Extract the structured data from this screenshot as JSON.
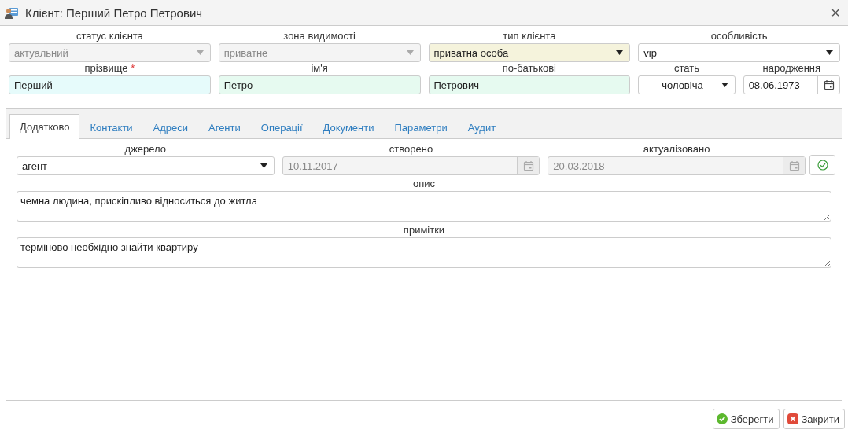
{
  "window": {
    "title": "Клієнт: Перший Петро Петрович",
    "close": "×"
  },
  "fields": [
    [
      {
        "label": "статус клієнта",
        "kind": "select",
        "value": "актуальний",
        "disabled": true
      },
      {
        "label": "зона видимості",
        "kind": "select",
        "value": "приватне",
        "disabled": true
      },
      {
        "label": "тип клієнта",
        "kind": "select",
        "value": "приватна особа",
        "disabled": false,
        "color": "#f5f3dc"
      },
      {
        "label": "особливість",
        "kind": "select",
        "value": "vip",
        "disabled": false
      }
    ],
    [
      {
        "label": "прізвище",
        "kind": "text",
        "value": "Перший",
        "disabled": false,
        "required_mark": "*",
        "color": "#e6fbfb"
      },
      {
        "label": "ім'я",
        "kind": "text",
        "value": "Петро",
        "disabled": false,
        "color": "#e6faf0"
      },
      {
        "label": "по-батькові",
        "kind": "text",
        "value": "Петрович",
        "disabled": false,
        "color": "#e6faf0"
      },
      {
        "fields": [
          {
            "label": "стать",
            "kind": "select",
            "value": "чоловіча",
            "disabled": false,
            "centered": true
          },
          {
            "label": "народження",
            "kind": "date",
            "value": "08.06.1973",
            "disabled": false
          }
        ]
      }
    ]
  ],
  "tabs": [
    {
      "label": "Додатково",
      "selected": true
    },
    {
      "label": "Контакти",
      "selected": false
    },
    {
      "label": "Адреси",
      "selected": false
    },
    {
      "label": "Агенти",
      "selected": false
    },
    {
      "label": "Операції",
      "selected": false
    },
    {
      "label": "Документи",
      "selected": false
    },
    {
      "label": "Параметри",
      "selected": false
    },
    {
      "label": "Аудит",
      "selected": false
    }
  ],
  "tab_fields": [
    {
      "label": "джерело",
      "kind": "select",
      "value": "агент",
      "disabled": false
    },
    {
      "label": "створено",
      "kind": "date",
      "value": "10.11.2017",
      "disabled": true
    },
    {
      "label": "актуалізовано",
      "kind": "date",
      "value": "20.03.2018",
      "disabled": true
    }
  ],
  "notes": [
    {
      "label": "опис",
      "value": "чемна людина, прискіпливо відноситься до житла"
    },
    {
      "label": "примітки",
      "value": "терміново необхідно знайти квартиру"
    }
  ],
  "buttons": [
    {
      "label": "Зберегти",
      "kind": "save"
    },
    {
      "label": "Закрити",
      "kind": "close"
    }
  ]
}
